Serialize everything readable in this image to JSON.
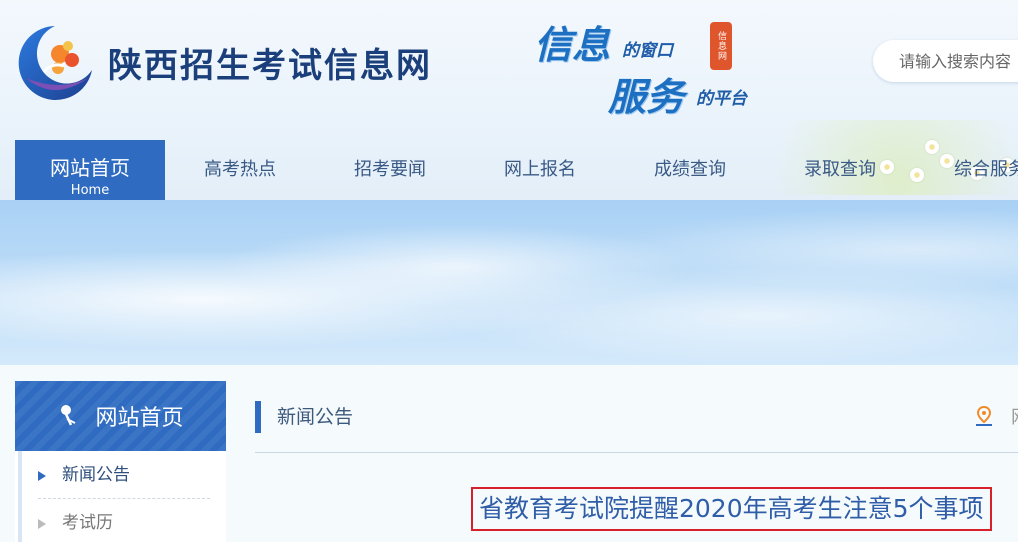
{
  "header": {
    "site_title": "陕西招生考试信息网",
    "slogan": {
      "line1_big": "信息",
      "line1_small": "的窗口",
      "line2_big": "服务",
      "line2_small": "的平台",
      "seal_text": "信息网"
    },
    "search": {
      "placeholder": "请输入搜索内容"
    }
  },
  "nav": {
    "items": [
      {
        "label": "网站首页",
        "sub": "Home",
        "active": true
      },
      {
        "label": "高考热点"
      },
      {
        "label": "招考要闻"
      },
      {
        "label": "网上报名"
      },
      {
        "label": "成绩查询"
      },
      {
        "label": "录取查询"
      },
      {
        "label": "综合服务"
      }
    ]
  },
  "sidebar": {
    "title": "网站首页",
    "items": [
      {
        "label": "新闻公告"
      },
      {
        "label": "考试历"
      }
    ]
  },
  "main": {
    "section_title": "新闻公告",
    "location_text": "网",
    "article_title": "省教育考试院提醒2020年高考生注意5个事项"
  },
  "colors": {
    "primary": "#2f6cc1",
    "title_blue": "#1b3f7a",
    "highlight_border": "#d7202a"
  }
}
